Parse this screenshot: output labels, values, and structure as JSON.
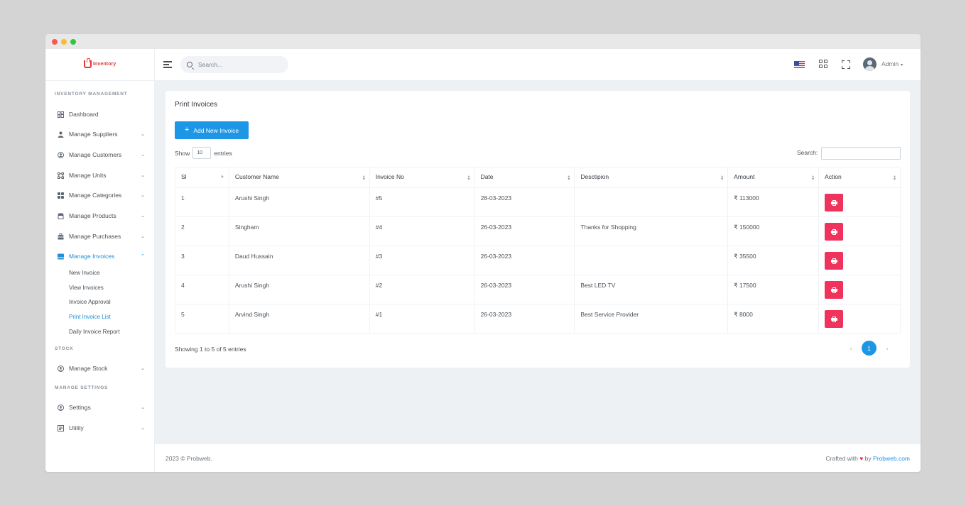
{
  "app": {
    "logo_text": "Inventory",
    "search_placeholder": "Search...",
    "user_name": "Admin"
  },
  "sidebar": {
    "sections": [
      {
        "title": "INVENTORY MANAGEMENT"
      },
      {
        "title": "STOCK"
      },
      {
        "title": "MANAGE SETTINGS"
      }
    ],
    "items": [
      {
        "label": "Dashboard",
        "icon": "dashboard-icon"
      },
      {
        "label": "Manage Suppliers",
        "icon": "user-icon"
      },
      {
        "label": "Manage Customers",
        "icon": "customers-icon"
      },
      {
        "label": "Manage Units",
        "icon": "units-icon"
      },
      {
        "label": "Manage Categories",
        "icon": "categories-icon"
      },
      {
        "label": "Manage Products",
        "icon": "products-icon"
      },
      {
        "label": "Manage Purchases",
        "icon": "purchases-icon"
      },
      {
        "label": "Manage Invoices",
        "icon": "invoices-icon"
      },
      {
        "label": "Manage Stock",
        "icon": "stock-icon"
      },
      {
        "label": "Settings",
        "icon": "settings-icon"
      },
      {
        "label": "Utility",
        "icon": "utility-icon"
      }
    ],
    "sub_items": [
      {
        "label": "New Invoice"
      },
      {
        "label": "View Invoices"
      },
      {
        "label": "Invoice Approval"
      },
      {
        "label": "Print Invoice List"
      },
      {
        "label": "Daily Invoice Report"
      }
    ]
  },
  "card": {
    "title": "Print Invoices",
    "add_button": "Add New Invoice",
    "show_label": "Show",
    "show_value": "10",
    "entries_label": "entries",
    "search_label": "Search:",
    "columns": [
      "Sl",
      "Customer Name",
      "Invoice No",
      "Date",
      "Desctipion",
      "Amount",
      "Action"
    ],
    "rows": [
      {
        "sl": "1",
        "customer": "Arushi Singh",
        "invoice": "#5",
        "date": "28-03-2023",
        "description": "",
        "amount": "₹ 113000"
      },
      {
        "sl": "2",
        "customer": "Singham",
        "invoice": "#4",
        "date": "26-03-2023",
        "description": "Thanks for Shopping",
        "amount": "₹ 150000"
      },
      {
        "sl": "3",
        "customer": "Daud Hussain",
        "invoice": "#3",
        "date": "26-03-2023",
        "description": "",
        "amount": "₹ 35500"
      },
      {
        "sl": "4",
        "customer": "Arushi Singh",
        "invoice": "#2",
        "date": "26-03-2023",
        "description": "Best LED TV",
        "amount": "₹ 17500"
      },
      {
        "sl": "5",
        "customer": "Arvind Singh",
        "invoice": "#1",
        "date": "26-03-2023",
        "description": "Best Service Provider",
        "amount": "₹ 8000"
      }
    ],
    "info": "Showing 1 to 5 of 5 entries",
    "current_page": "1",
    "prev": "‹",
    "next": "›"
  },
  "footer": {
    "copyright": "2023 © Probweb.",
    "crafted": "Crafted with",
    "by": "by",
    "link": "Probweb.com"
  },
  "colors": {
    "accent": "#1e96e6",
    "danger": "#f0335c",
    "logo": "#e23a3a"
  }
}
